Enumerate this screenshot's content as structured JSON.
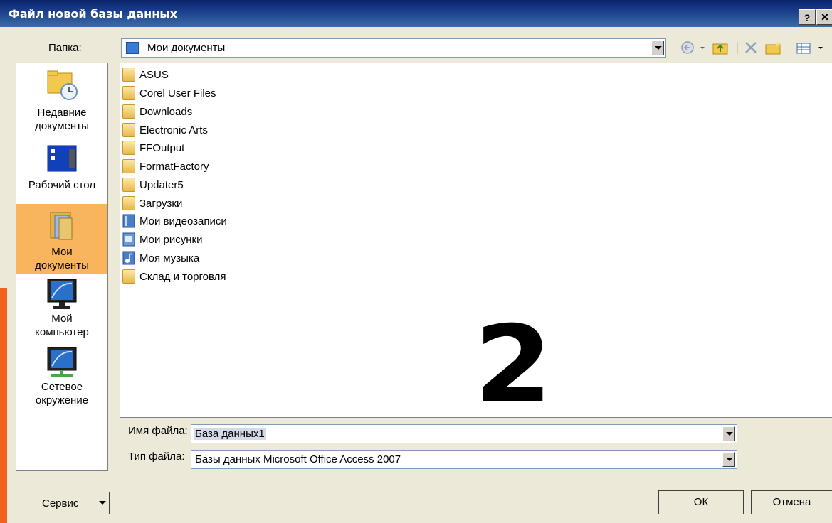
{
  "window": {
    "title": "Файл новой базы данных",
    "help_label": "?",
    "close_label": "×"
  },
  "folder_row": {
    "label": "Папка:",
    "current": "Мои документы"
  },
  "places": [
    {
      "label": "Недавние документы",
      "icon": "recent-documents-icon"
    },
    {
      "label": "Рабочий стол",
      "icon": "desktop-icon"
    },
    {
      "label": "Мои документы",
      "icon": "my-documents-icon",
      "selected": true
    },
    {
      "label": "Мой компьютер",
      "icon": "my-computer-icon"
    },
    {
      "label": "Сетевое окружение",
      "icon": "network-icon"
    }
  ],
  "files": [
    {
      "name": "ASUS",
      "icon": "folder-icon"
    },
    {
      "name": "Corel User Files",
      "icon": "folder-icon"
    },
    {
      "name": "Downloads",
      "icon": "folder-icon"
    },
    {
      "name": "Electronic Arts",
      "icon": "folder-icon"
    },
    {
      "name": "FFOutput",
      "icon": "folder-icon"
    },
    {
      "name": "FormatFactory",
      "icon": "folder-icon"
    },
    {
      "name": "Updater5",
      "icon": "folder-icon"
    },
    {
      "name": "Загрузки",
      "icon": "folder-icon"
    },
    {
      "name": "Мои видеозаписи",
      "icon": "videos-folder-icon"
    },
    {
      "name": "Мои рисунки",
      "icon": "pictures-folder-icon"
    },
    {
      "name": "Моя музыка",
      "icon": "music-folder-icon"
    },
    {
      "name": "Склад и торговля",
      "icon": "folder-icon"
    }
  ],
  "overlay_number": "2",
  "filename": {
    "label": "Имя файла:",
    "value": "База данных1"
  },
  "filetype": {
    "label": "Тип файла:",
    "value": "Базы данных Microsoft Office Access 2007"
  },
  "buttons": {
    "service": "Сервис",
    "ok": "ОК",
    "cancel": "Отмена"
  },
  "colors": {
    "titlebar": "#0a246a",
    "selected_place": "#f9b55d",
    "accent_strip": "#f26322"
  }
}
